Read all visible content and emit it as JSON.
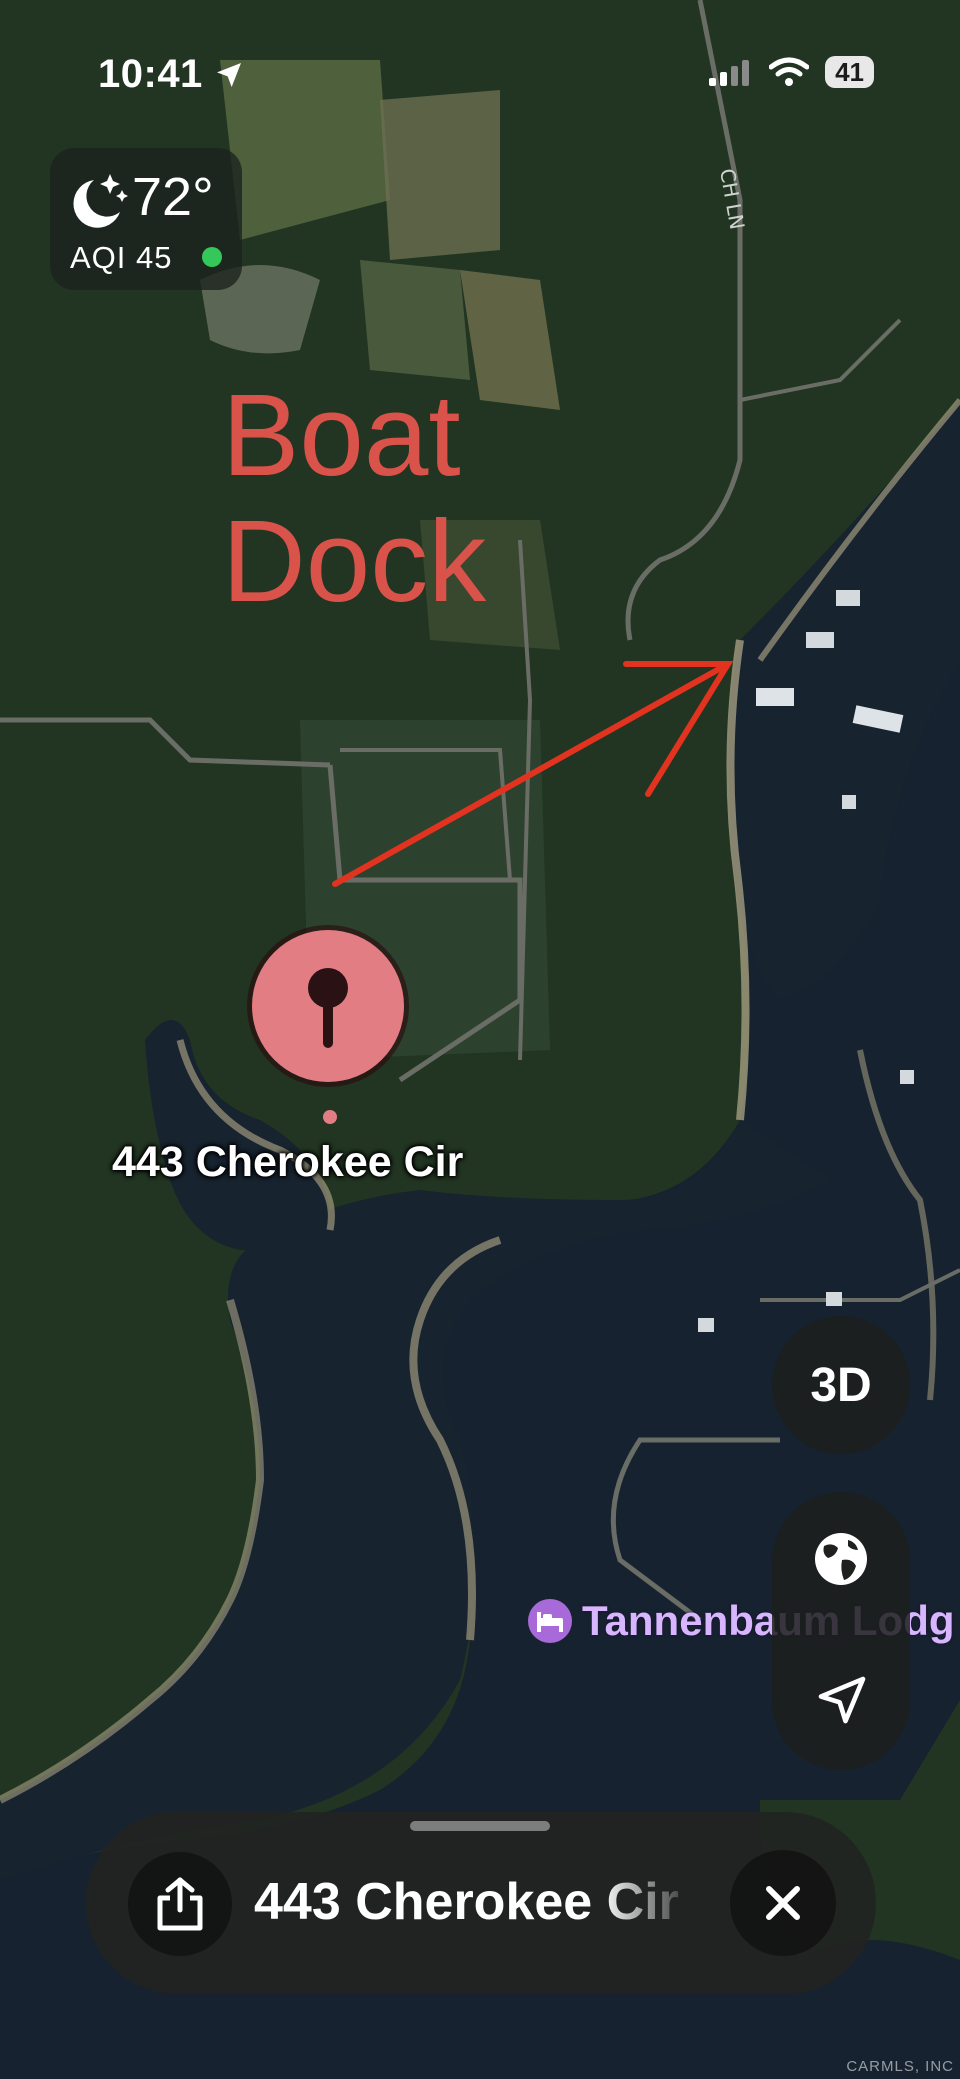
{
  "status_bar": {
    "time": "10:41",
    "battery": "41"
  },
  "weather": {
    "temperature": "72°",
    "aqi": "AQI 45",
    "aqi_status_color": "#34c759"
  },
  "map": {
    "road_label": "CH LN",
    "annotation": [
      "Boat",
      "Dock"
    ],
    "annotation_color": "#d9534a",
    "pin": {
      "label": "443 Cherokee Cir",
      "color": "#e27d83"
    },
    "poi": {
      "label": "Tannenbaum Lodg",
      "category": "bed-icon",
      "color": "#a86ad8"
    }
  },
  "controls": {
    "mode_3d_label": "3D",
    "globe": "globe-icon",
    "location": "location-arrow-icon"
  },
  "place_card": {
    "title": "443 Cherokee Cir",
    "share": "share-icon",
    "close": "close-icon"
  },
  "watermark": "CARMLS, INC"
}
